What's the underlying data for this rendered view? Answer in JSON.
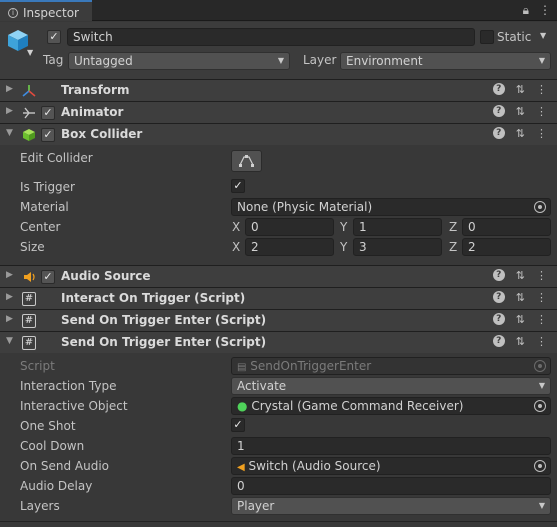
{
  "tab": {
    "title": "Inspector"
  },
  "header": {
    "object_name": "Switch",
    "static_label": "Static",
    "tag_label": "Tag",
    "tag_value": "Untagged",
    "layer_label": "Layer",
    "layer_value": "Environment"
  },
  "components": {
    "transform": {
      "title": "Transform"
    },
    "animator": {
      "title": "Animator"
    },
    "box_collider": {
      "title": "Box Collider",
      "edit_collider_label": "Edit Collider",
      "is_trigger_label": "Is Trigger",
      "material_label": "Material",
      "material_value": "None (Physic Material)",
      "center_label": "Center",
      "center": {
        "x": "0",
        "y": "1",
        "z": "0"
      },
      "size_label": "Size",
      "size": {
        "x": "2",
        "y": "3",
        "z": "2"
      }
    },
    "audio_source": {
      "title": "Audio Source"
    },
    "interact_on_trigger": {
      "title": "Interact On Trigger (Script)"
    },
    "send_on_trigger_enter_1": {
      "title": "Send On Trigger Enter (Script)"
    },
    "send_on_trigger_enter_2": {
      "title": "Send On Trigger Enter (Script)",
      "script_label": "Script",
      "script_value": "SendOnTriggerEnter",
      "interaction_type_label": "Interaction Type",
      "interaction_type_value": "Activate",
      "interactive_object_label": "Interactive Object",
      "interactive_object_value": "Crystal (Game Command Receiver)",
      "one_shot_label": "One Shot",
      "cool_down_label": "Cool Down",
      "cool_down_value": "1",
      "on_send_audio_label": "On Send Audio",
      "on_send_audio_value": "Switch (Audio Source)",
      "audio_delay_label": "Audio Delay",
      "audio_delay_value": "0",
      "layers_label": "Layers",
      "layers_value": "Player"
    }
  },
  "axes": {
    "x": "X",
    "y": "Y",
    "z": "Z"
  },
  "colors": {
    "accent": "#3a79bb",
    "background": "#383838",
    "header": "#3e3e3e"
  }
}
